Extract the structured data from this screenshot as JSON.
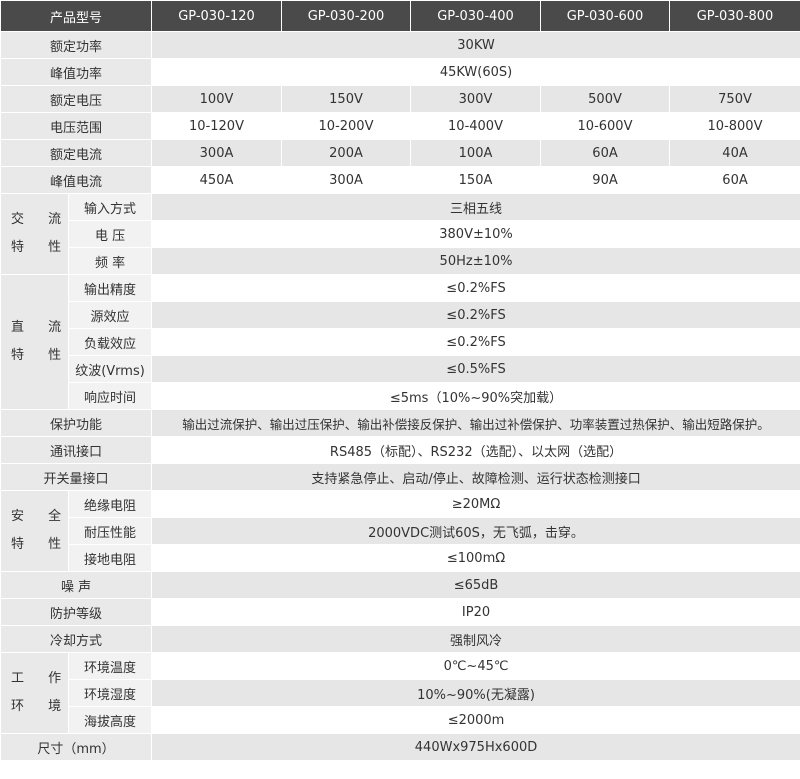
{
  "header": {
    "col0": "产品型号",
    "models": [
      "GP-030-120",
      "GP-030-200",
      "GP-030-400",
      "GP-030-600",
      "GP-030-800"
    ]
  },
  "rated_power": {
    "label": "额定功率",
    "value": "30KW"
  },
  "peak_power": {
    "label": "峰值功率",
    "value": "45KW(60S)"
  },
  "rated_voltage": {
    "label": "额定电压",
    "values": [
      "100V",
      "150V",
      "300V",
      "500V",
      "750V"
    ]
  },
  "voltage_range": {
    "label": "电压范围",
    "values": [
      "10-120V",
      "10-200V",
      "10-400V",
      "10-600V",
      "10-800V"
    ]
  },
  "rated_current": {
    "label": "额定电流",
    "values": [
      "300A",
      "200A",
      "100A",
      "60A",
      "40A"
    ]
  },
  "peak_current": {
    "label": "峰值电流",
    "values": [
      "450A",
      "300A",
      "150A",
      "90A",
      "60A"
    ]
  },
  "ac": {
    "group_line1": "交 流",
    "group_line2": "特 性",
    "input_mode": {
      "label": "输入方式",
      "value": "三相五线"
    },
    "voltage": {
      "label": "电 压",
      "value": "380V±10%"
    },
    "frequency": {
      "label": "频 率",
      "value": "50Hz±10%"
    }
  },
  "dc": {
    "group_line1": "直 流",
    "group_line2": "特 性",
    "output_accuracy": {
      "label": "输出精度",
      "value": "≤0.2%FS"
    },
    "source_effect": {
      "label": "源效应",
      "value": "≤0.2%FS"
    },
    "load_effect": {
      "label": "负载效应",
      "value": "≤0.2%FS"
    },
    "ripple": {
      "label": "纹波(Vrms)",
      "value": "≤0.5%FS"
    },
    "response_time": {
      "label": "响应时间",
      "value": "≤5ms（10%~90%突加载）"
    }
  },
  "protection": {
    "label": "保护功能",
    "value": "输出过流保护、输出过压保护、输出补偿接反保护、输出过补偿保护、功率装置过热保护、输出短路保护。"
  },
  "communication": {
    "label": "通讯接口",
    "value": "RS485（标配）、RS232（选配）、以太网（选配）"
  },
  "switch_interface": {
    "label": "开关量接口",
    "value": "支持紧急停止、启动/停止、故障检测、运行状态检测接口"
  },
  "safety": {
    "group_line1": "安 全",
    "group_line2": "特 性",
    "insulation": {
      "label": "绝缘电阻",
      "value": "≥20MΩ"
    },
    "withstand": {
      "label": "耐压性能",
      "value": "2000VDC测试60S，无飞弧，击穿。"
    },
    "grounding": {
      "label": "接地电阻",
      "value": "≤100mΩ"
    }
  },
  "noise": {
    "label": "噪 声",
    "value": "≤65dB"
  },
  "ip_rating": {
    "label": "防护等级",
    "value": "IP20"
  },
  "cooling": {
    "label": "冷却方式",
    "value": "强制风冷"
  },
  "env": {
    "group_line1": "工 作",
    "group_line2": "环 境",
    "temperature": {
      "label": "环境温度",
      "value": "0℃~45℃"
    },
    "humidity": {
      "label": "环境湿度",
      "value": "10%~90%(无凝露)"
    },
    "altitude": {
      "label": "海拔高度",
      "value": "≤2000m"
    }
  },
  "size": {
    "label": "尺寸（mm）",
    "value": "440Wx975Hx600D"
  }
}
